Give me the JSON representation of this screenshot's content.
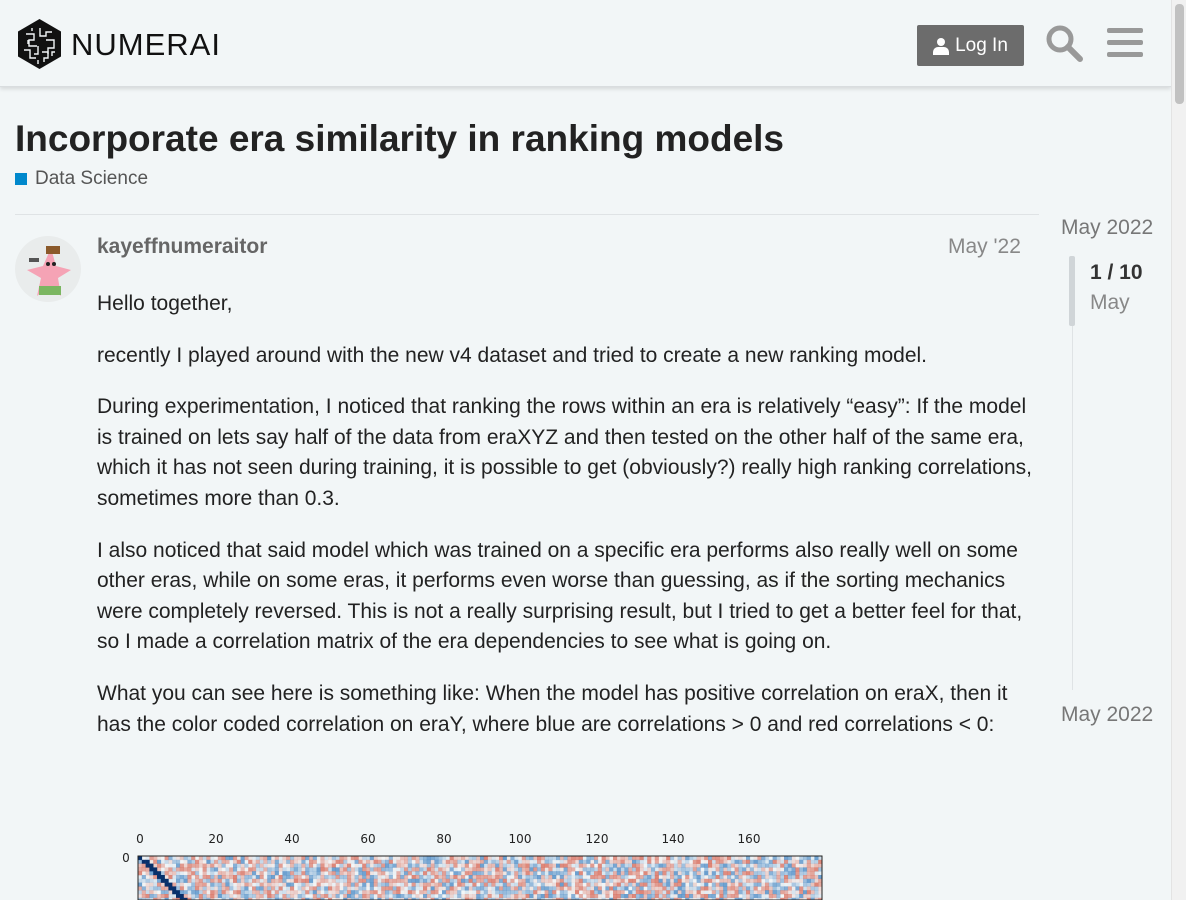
{
  "header": {
    "brand": "NUMERAI",
    "login_label": "Log In",
    "login_icon": "user-icon",
    "search_icon": "search-icon",
    "menu_icon": "hamburger-menu-icon"
  },
  "topic": {
    "title": "Incorporate era similarity in ranking models",
    "category": "Data Science",
    "category_color": "#0088cc"
  },
  "post": {
    "username": "kayeffnumeraitor",
    "date": "May '22",
    "paragraphs": [
      "Hello together,",
      "recently I played around with the new v4 dataset and tried to create a new ranking model.",
      "During experimentation, I noticed that ranking the rows within an era is relatively “easy”: If the model is trained on lets say half of the data from eraXYZ and then tested on the other half of the same era, which it has not seen during training, it is possible to get (obviously?) really high ranking correlations, sometimes more than 0.3.",
      "I also noticed that said model which was trained on a specific era performs also really well on some other eras, while on some eras, it performs even worse than guessing, as if the sorting mechanics were completely reversed. This is not a really surprising result, but I tried to get a better feel for that, so I made a correlation matrix of the era dependencies to see what is going on.",
      "What you can see here is something like: When the model has positive correlation on eraX, then it has the color coded correlation on eraY, where blue are correlations > 0 and red correlations < 0:"
    ],
    "figure": {
      "x_ticks": [
        "0",
        "20",
        "40",
        "60",
        "80",
        "100",
        "120",
        "140",
        "160"
      ],
      "y_ticks": [
        "0"
      ],
      "positive_color": "#3a7fc0",
      "negative_color": "#d6604d"
    }
  },
  "timeline": {
    "start_label": "May 2022",
    "position": "1 / 10",
    "current_month": "May",
    "end_label": "May 2022"
  }
}
